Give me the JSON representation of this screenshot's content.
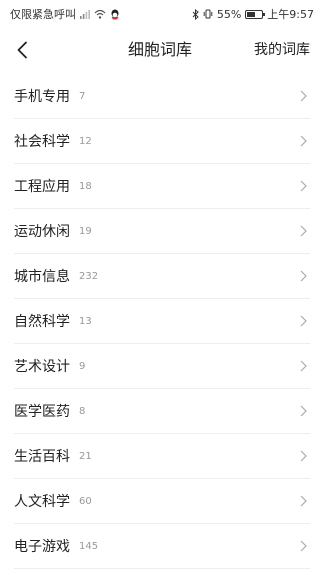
{
  "status_bar": {
    "left_text": "仅限紧急呼叫",
    "battery_text": "55%",
    "battery_level": 0.55,
    "time": "上午9:57",
    "icons": [
      "signal-icon",
      "wifi-icon",
      "qq-icon",
      "bluetooth-icon",
      "vibrate-icon",
      "battery-icon"
    ]
  },
  "header": {
    "title": "细胞词库",
    "action_label": "我的词库",
    "back_icon": "back-arrow-icon"
  },
  "categories": [
    {
      "name": "手机专用",
      "count": "7"
    },
    {
      "name": "社会科学",
      "count": "12"
    },
    {
      "name": "工程应用",
      "count": "18"
    },
    {
      "name": "运动休闲",
      "count": "19"
    },
    {
      "name": "城市信息",
      "count": "232"
    },
    {
      "name": "自然科学",
      "count": "13"
    },
    {
      "name": "艺术设计",
      "count": "9"
    },
    {
      "name": "医学医药",
      "count": "8"
    },
    {
      "name": "生活百科",
      "count": "21"
    },
    {
      "name": "人文科学",
      "count": "60"
    },
    {
      "name": "电子游戏",
      "count": "145"
    }
  ],
  "colors": {
    "text": "#222222",
    "count": "#999999",
    "divider": "#eeeeee",
    "chevron": "#aaaaaa"
  }
}
